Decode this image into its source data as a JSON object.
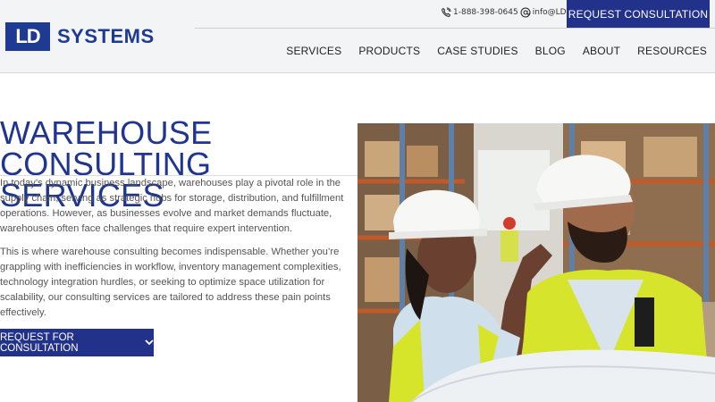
{
  "brand": {
    "logo_mark": "LD",
    "logo_text": "SYSTEMS",
    "color": "#1f3a93"
  },
  "contact": {
    "phone": "1-888-398-0645",
    "email": "info@LDSLC.com"
  },
  "header": {
    "cta_label": "REQUEST CONSULTATION"
  },
  "nav": {
    "items": [
      "SERVICES",
      "PRODUCTS",
      "CASE STUDIES",
      "BLOG",
      "ABOUT",
      "RESOURCES"
    ]
  },
  "hero": {
    "title_line1": "WAREHOUSE",
    "title_line2": "CONSULTING SERVICES",
    "paragraph1": "In today’s dynamic business landscape, warehouses play a pivotal role in the supply chain, serving as strategic hubs for storage, distribution, and fulfillment operations. However, as businesses evolve and market demands fluctuate, warehouses often face challenges that require expert intervention.",
    "paragraph2": "This is where warehouse consulting becomes indispensable. Whether you’re grappling with inefficiencies in workflow, inventory management complexities, technology integration hurdles, or seeking to optimize space utilization for scalability, our consulting services are tailored to address these pain points effectively.",
    "cta_label": "REQUEST FOR CONSULTATION"
  },
  "colors": {
    "accent": "#22318a",
    "title": "#1f3590",
    "header_bg": "#f3f4f6"
  }
}
